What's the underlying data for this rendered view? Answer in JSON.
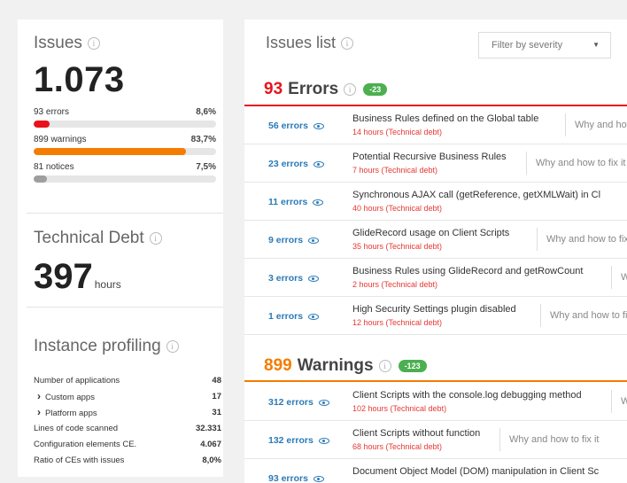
{
  "issues": {
    "title": "Issues",
    "total": "1.073",
    "stats": [
      {
        "label": "93 errors",
        "pct": "8,6%",
        "value": 8.6,
        "color": "#e8121c"
      },
      {
        "label": "899 warnings",
        "pct": "83,7%",
        "value": 83.7,
        "color": "#f57c00"
      },
      {
        "label": "81 notices",
        "pct": "7,5%",
        "value": 7.5,
        "color": "#9e9e9e"
      }
    ]
  },
  "debt": {
    "title": "Technical Debt",
    "value": "397",
    "unit": "hours"
  },
  "profiling": {
    "title": "Instance profiling",
    "rows": [
      {
        "label": "Number of applications",
        "value": "48"
      },
      {
        "label": "Custom apps",
        "value": "17",
        "sub": true
      },
      {
        "label": "Platform apps",
        "value": "31",
        "sub": true
      },
      {
        "label": "Lines of code scanned",
        "value": "32.331"
      },
      {
        "label": "Configuration elements CE.",
        "value": "4.067"
      },
      {
        "label": "Ratio of CEs with issues",
        "value": "8,0%"
      }
    ]
  },
  "list": {
    "title": "Issues list",
    "filter_placeholder": "Filter by severity",
    "fix_label": "Why and how to fix it",
    "errors": {
      "count": "93",
      "label": "Errors",
      "badge": "-23",
      "color": "#e8121c",
      "items": [
        {
          "count": "56 errors",
          "title": "Business Rules defined on the Global table",
          "debt": "14 hours (Technical debt)"
        },
        {
          "count": "23 errors",
          "title": "Potential Recursive Business Rules",
          "debt": "7 hours (Technical debt)"
        },
        {
          "count": "11 errors",
          "title": "Synchronous AJAX call (getReference, getXMLWait) in Cl",
          "debt": "40 hours (Technical debt)"
        },
        {
          "count": "9 errors",
          "title": "GlideRecord usage on Client Scripts",
          "debt": "35 hours (Technical debt)"
        },
        {
          "count": "3 errors",
          "title": "Business Rules using GlideRecord and getRowCount",
          "debt": "2 hours (Technical debt)"
        },
        {
          "count": "1 errors",
          "title": "High Security Settings plugin disabled",
          "debt": "12 hours (Technical debt)"
        }
      ]
    },
    "warnings": {
      "count": "899",
      "label": "Warnings",
      "badge": "-123",
      "color": "#f57c00",
      "items": [
        {
          "count": "312 errors",
          "title": "Client Scripts with the console.log debugging method",
          "debt": "102 hours (Technical debt)"
        },
        {
          "count": "132 errors",
          "title": "Client Scripts without function",
          "debt": "68 hours (Technical debt)"
        },
        {
          "count": "93 errors",
          "title": "Document Object Model (DOM) manipulation in Client Sc",
          "debt": ""
        }
      ]
    }
  }
}
